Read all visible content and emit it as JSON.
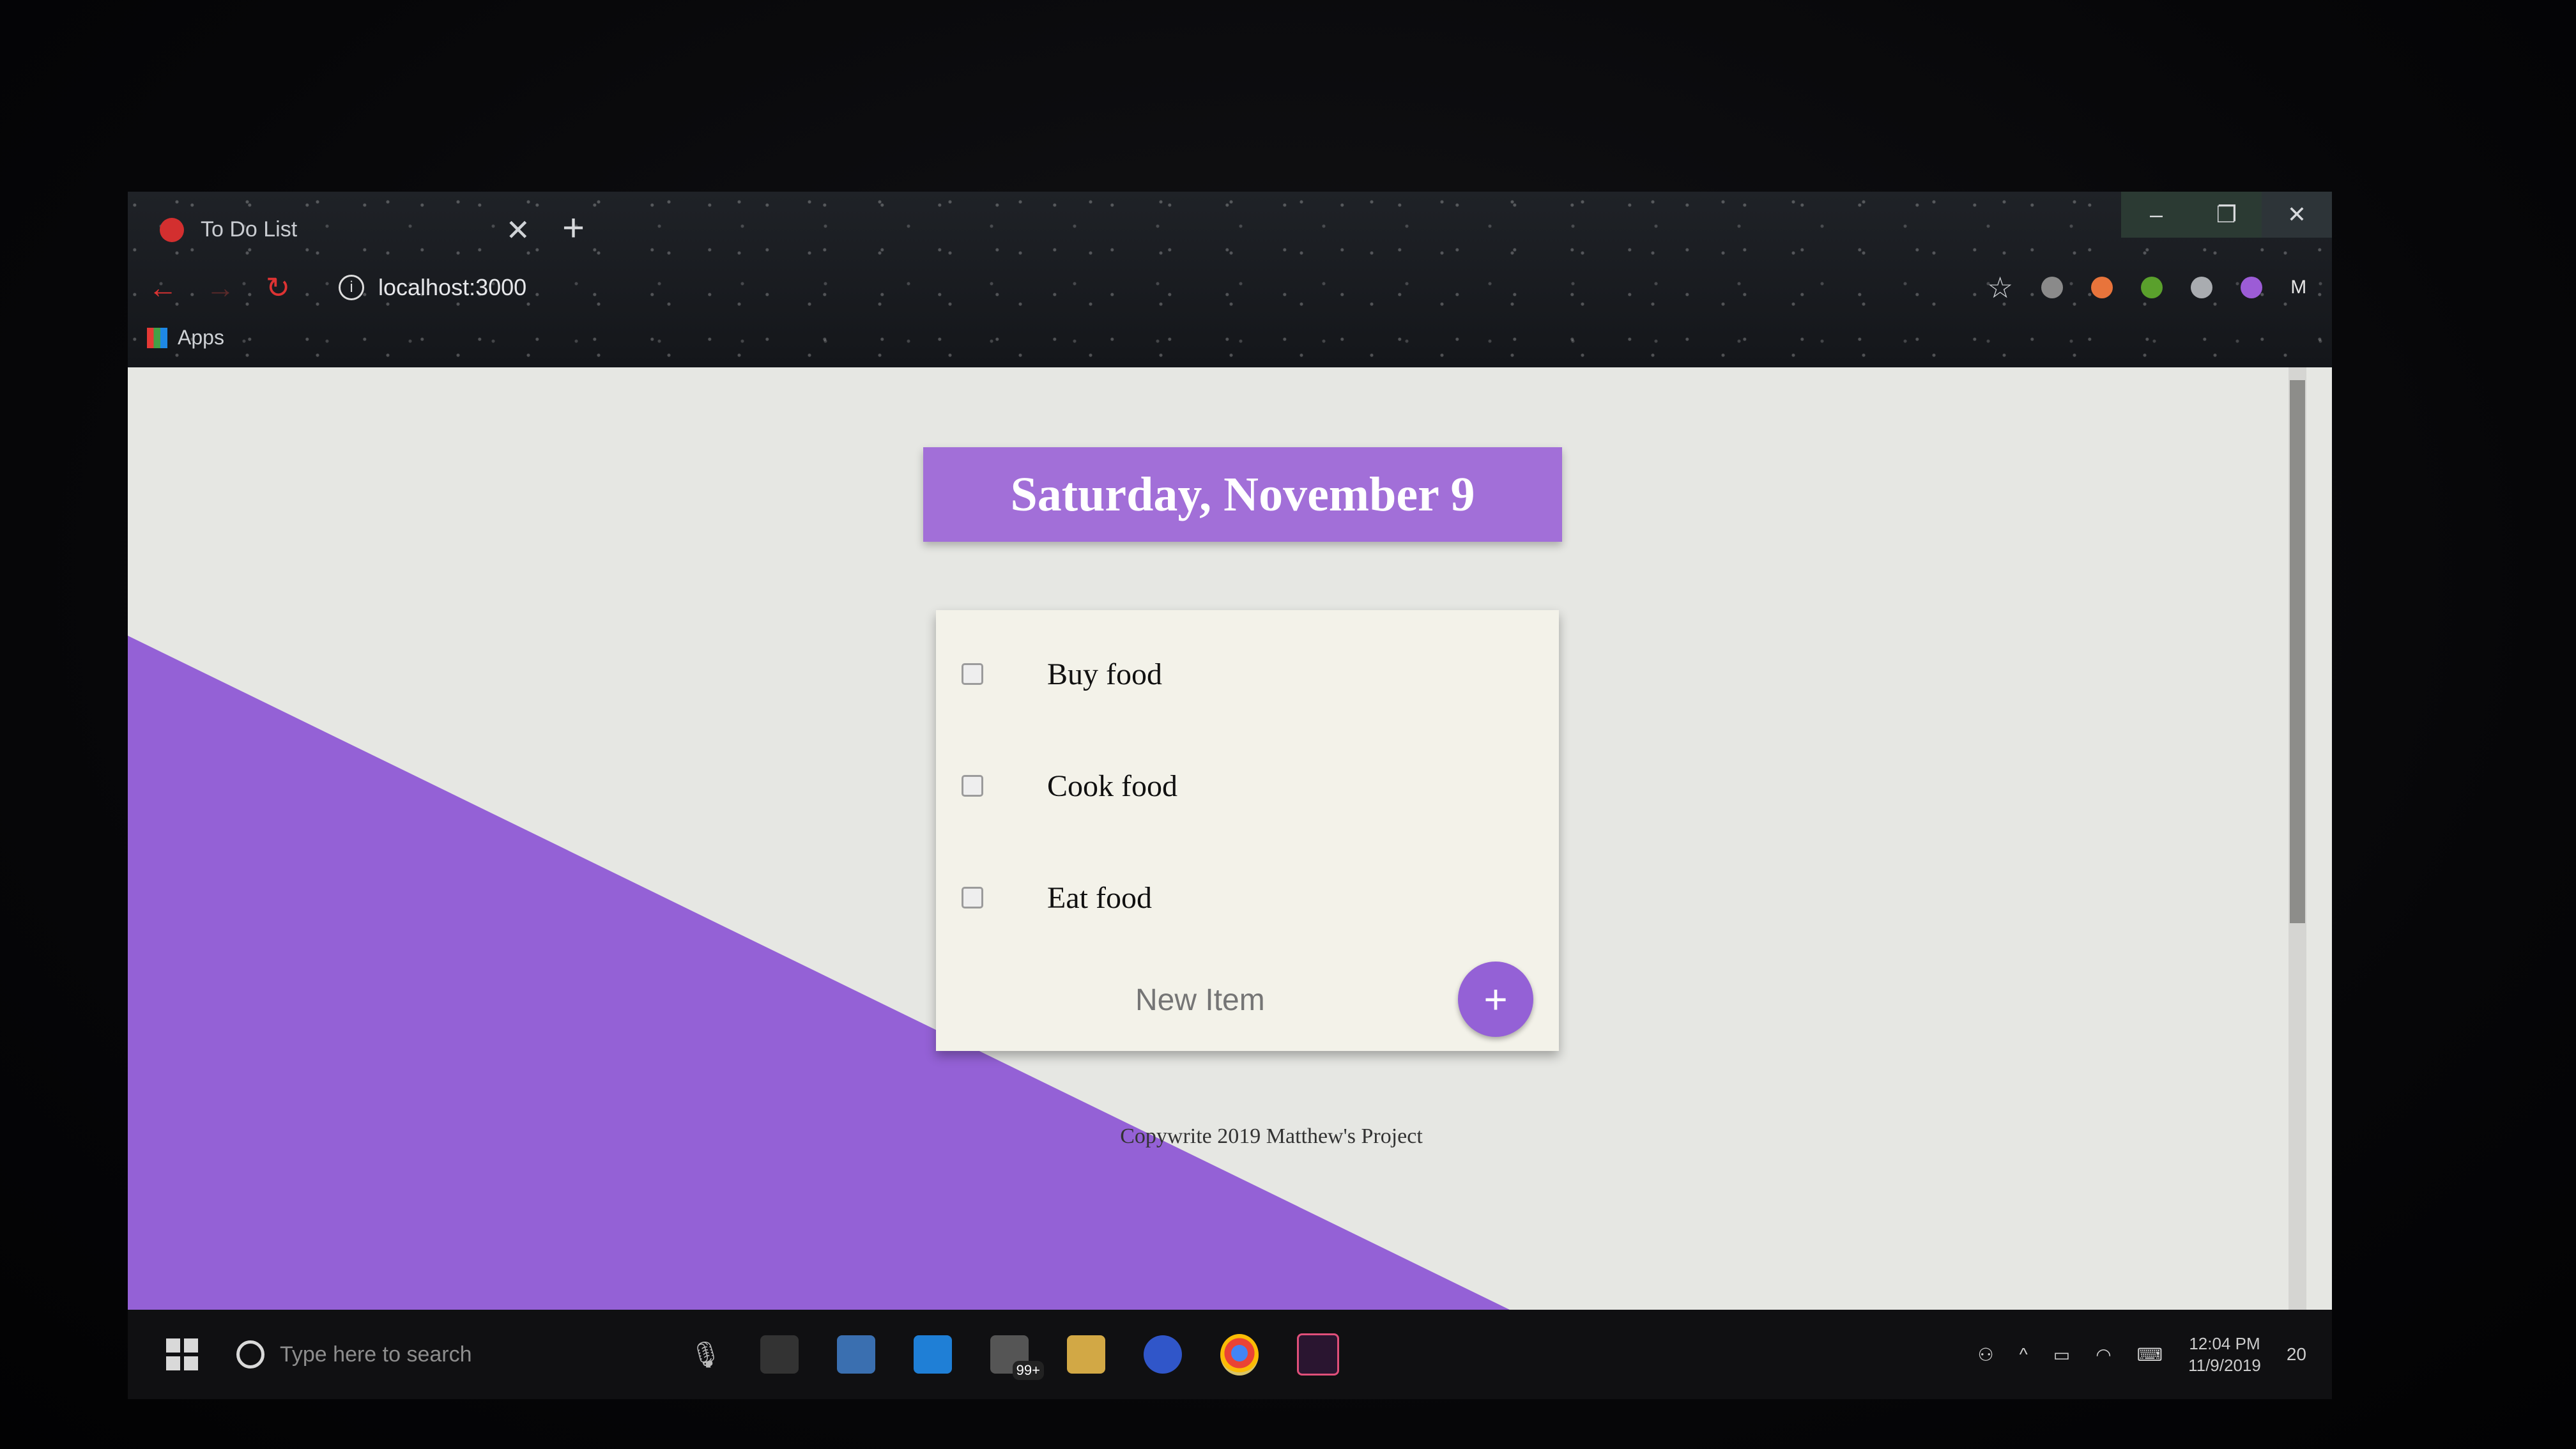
{
  "browser": {
    "tab_title": "To Do List",
    "tab_close": "✕",
    "new_tab": "+",
    "url": "localhost:3000",
    "bookmarks_apps": "Apps",
    "profile_initial": "M",
    "window_controls": {
      "minimize": "–",
      "restore": "❐",
      "close": "✕"
    }
  },
  "app": {
    "date_heading": "Saturday, November 9",
    "items": [
      {
        "label": "Buy food",
        "checked": false
      },
      {
        "label": "Cook food",
        "checked": false
      },
      {
        "label": "Eat food",
        "checked": false
      }
    ],
    "new_item_placeholder": "New Item",
    "add_button_label": "+",
    "footer": "Copywrite 2019 Matthew's Project",
    "accent_color": "#9461d6"
  },
  "taskbar": {
    "search_placeholder": "Type here to search",
    "time": "12:04 PM",
    "date": "11/9/2019",
    "mail_badge": "99+",
    "notification_count": "20"
  }
}
